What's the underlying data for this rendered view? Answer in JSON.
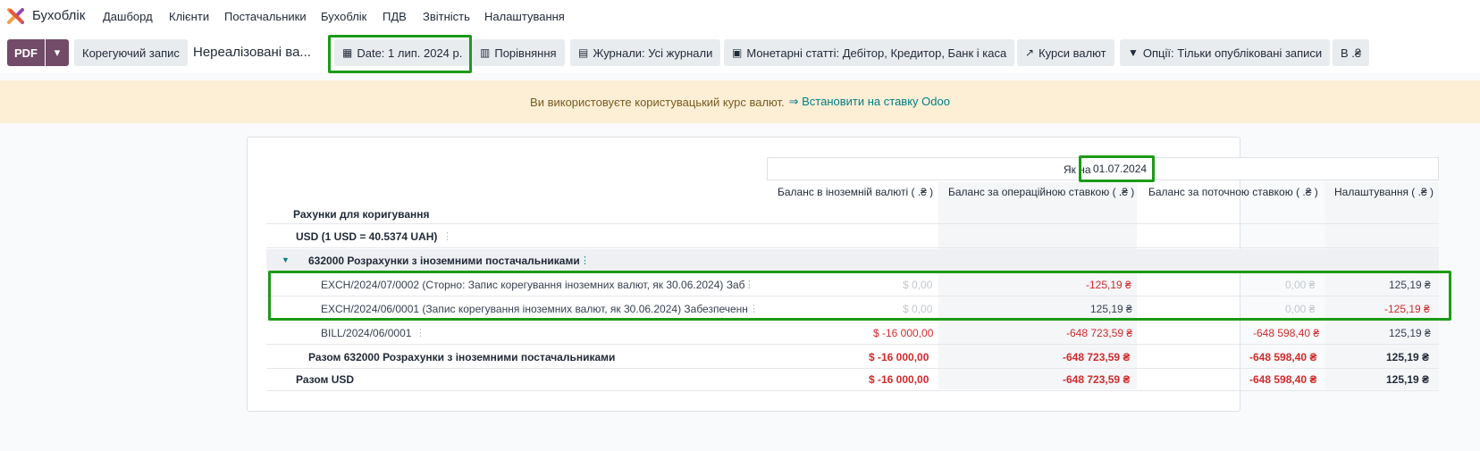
{
  "nav": {
    "brand": "Бухоблік",
    "menu": [
      "Дашборд",
      "Клієнти",
      "Постачальники",
      "Бухоблік",
      "ПДВ",
      "Звітність",
      "Налаштування"
    ]
  },
  "toolbar": {
    "pdf_label": "PDF",
    "dropdown_icon": "caret-down-icon",
    "adjust_label": "Корегуючий запис",
    "report_name": "Нереалізовані ва...",
    "date_label": "Date: 1 лип. 2024 р.",
    "compare_label": "Порівняння",
    "journals_label": "Журнали: Усі журнали",
    "monetary_label": "Монетарні статті: Дебітор, Кредитор, Банк і каса",
    "rates_label": "Курси валют",
    "options_label": "Опції: Тільки опубліковані записи",
    "currency_label": "В .₴"
  },
  "alert": {
    "text": "Ви використовуєте користувацький курс валют.",
    "link": "⇒ Встановити на ставку Odoo"
  },
  "report": {
    "asof_prefix": "Як на",
    "asof_date": "01.07.2024",
    "title": "Рахунки для коригування",
    "columns": [
      "Баланс в іноземній валюті ( .₴ )",
      "Баланс за операційною ставкою ( .₴ )",
      "Баланс за поточною ставкою ( .₴ )",
      "Налаштування ( .₴ )"
    ],
    "currency_group": "USD (1 USD = 40.5374 UAH)",
    "account_group": "632000 Розрахунки з іноземними постачальниками",
    "lines": [
      {
        "name": "EXCH/2024/07/0002 (Сторно: Запис корегування іноземних валют, як 30.06.2024) Заб",
        "c1": "$ 0,00",
        "c2": "-125,19 ₴",
        "c3": "0,00 ₴",
        "c4": "125,19 ₴"
      },
      {
        "name": "EXCH/2024/06/0001 (Запис корегування іноземних валют, як 30.06.2024) Забезпеченн",
        "c1": "$ 0,00",
        "c2": "125,19 ₴",
        "c3": "0,00 ₴",
        "c4": "-125,19 ₴"
      },
      {
        "name": "BILL/2024/06/0001",
        "c1": "$ -16 000,00",
        "c2": "-648 723,59 ₴",
        "c3": "-648 598,40 ₴",
        "c4": "125,19 ₴"
      }
    ],
    "account_total": {
      "name": "Разом 632000 Розрахунки з іноземними постачальниками",
      "c1": "$ -16 000,00",
      "c2": "-648 723,59 ₴",
      "c3": "-648 598,40 ₴",
      "c4": "125,19 ₴"
    },
    "currency_total": {
      "name": "Разом USD",
      "c1": "$ -16 000,00",
      "c2": "-648 723,59 ₴",
      "c3": "-648 598,40 ₴",
      "c4": "125,19 ₴"
    }
  },
  "colors": {
    "primary": "#714b67",
    "highlight": "#1c9a18",
    "negative": "#d12a2a",
    "link": "#017e84"
  }
}
